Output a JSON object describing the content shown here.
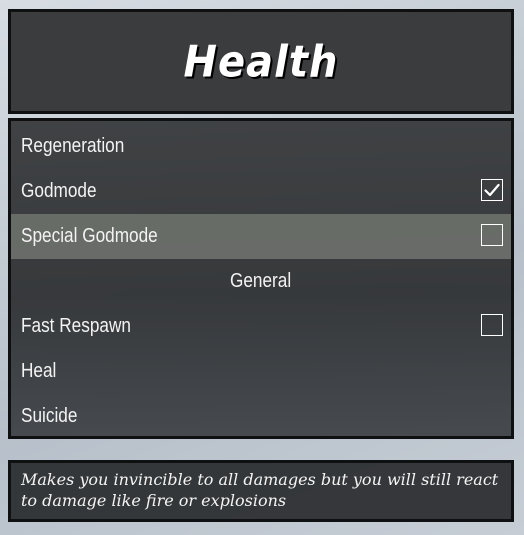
{
  "header": {
    "title": "Health"
  },
  "menu": {
    "items": [
      {
        "label": "Regeneration",
        "type": "option"
      },
      {
        "label": "Godmode",
        "type": "toggle",
        "checked": true
      },
      {
        "label": "Special Godmode",
        "type": "toggle",
        "checked": false,
        "selected": true
      },
      {
        "label": "General",
        "type": "section"
      },
      {
        "label": "Fast Respawn",
        "type": "toggle",
        "checked": false
      },
      {
        "label": "Heal",
        "type": "option"
      },
      {
        "label": "Suicide",
        "type": "option"
      }
    ]
  },
  "description": {
    "text": "Makes you invincible to all damages but you will still react to damage like fire or explosions"
  },
  "colors": {
    "panel_bg": "#303234",
    "border": "#0f1012",
    "selected_bg": "#787c76",
    "text": "#f3f3f3"
  }
}
